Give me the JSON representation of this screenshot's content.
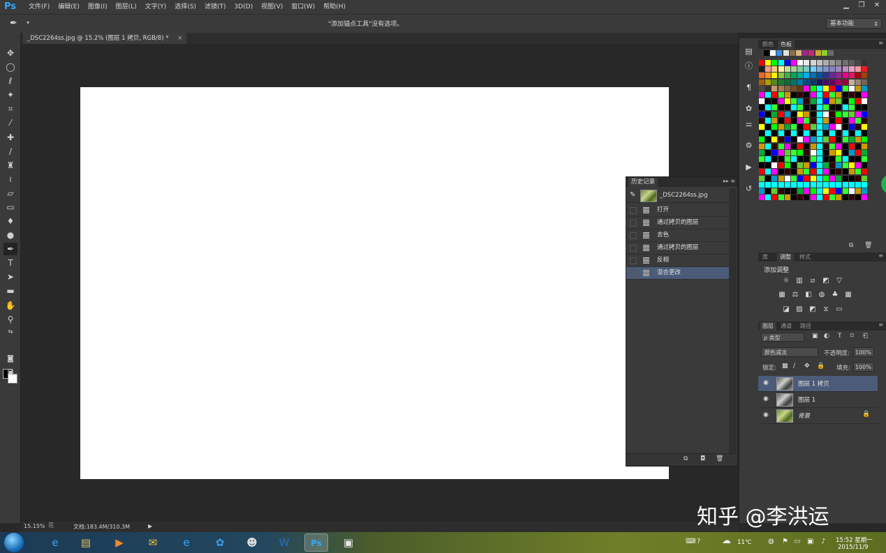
{
  "app": {
    "logo": "Ps",
    "menu": [
      "文件(F)",
      "编辑(E)",
      "图像(I)",
      "图层(L)",
      "文字(Y)",
      "选择(S)",
      "滤镜(T)",
      "3D(D)",
      "视图(V)",
      "窗口(W)",
      "帮助(H)"
    ],
    "window_controls": [
      "▁",
      "❐",
      "✕"
    ]
  },
  "options_bar": {
    "tool_icon": "pen-tool-icon",
    "message": "\"添加锚点工具\"没有选项。",
    "workspace": "基本功能"
  },
  "document": {
    "tab_title": "_DSC2264ss.jpg @ 15.2% (图层 1 拷贝, RGB/8) *",
    "tab_close": "×",
    "canvas_color": "#ffffff"
  },
  "status": {
    "zoom": "15.15%",
    "doc_size": "文档:183.4M/310.3M"
  },
  "history": {
    "tab_label": "历史记录",
    "snapshot_label": "_DSC2264ss.jpg",
    "items": [
      "打开",
      "通过拷贝的图层",
      "去色",
      "通过拷贝的图层",
      "反相",
      "混合更改"
    ],
    "selected_index": 5
  },
  "swatches_panel": {
    "tabs": [
      "颜色",
      "色板"
    ],
    "active_tab": "色板"
  },
  "adjustments_panel": {
    "tabs": [
      "库",
      "调整",
      "样式"
    ],
    "active_tab": "调整",
    "title": "添加调整"
  },
  "layers_panel": {
    "tabs": [
      "图层",
      "通道",
      "路径"
    ],
    "active_tab": "图层",
    "filter_kind": "ρ 类型",
    "blend_mode": "颜色减淡",
    "opacity_label": "不透明度:",
    "opacity": "100%",
    "lock_label": "锁定:",
    "fill_label": "填充:",
    "fill": "100%",
    "layers": [
      {
        "name": "图层 1 拷贝",
        "selected": true,
        "locked": false,
        "italic": false,
        "thumb": "gray"
      },
      {
        "name": "图层 1",
        "selected": false,
        "locked": false,
        "italic": false,
        "thumb": "gray"
      },
      {
        "name": "背景",
        "selected": false,
        "locked": true,
        "italic": true,
        "thumb": "color"
      }
    ]
  },
  "taskbar": {
    "temperature": "11℃",
    "time": "15:52 星期一",
    "date": "2015/11/9"
  },
  "watermark": "知乎 @李洪运",
  "colors": {
    "selection": "#4b5b79",
    "panel": "#3a3a3a",
    "accent": "#31a8ff"
  }
}
